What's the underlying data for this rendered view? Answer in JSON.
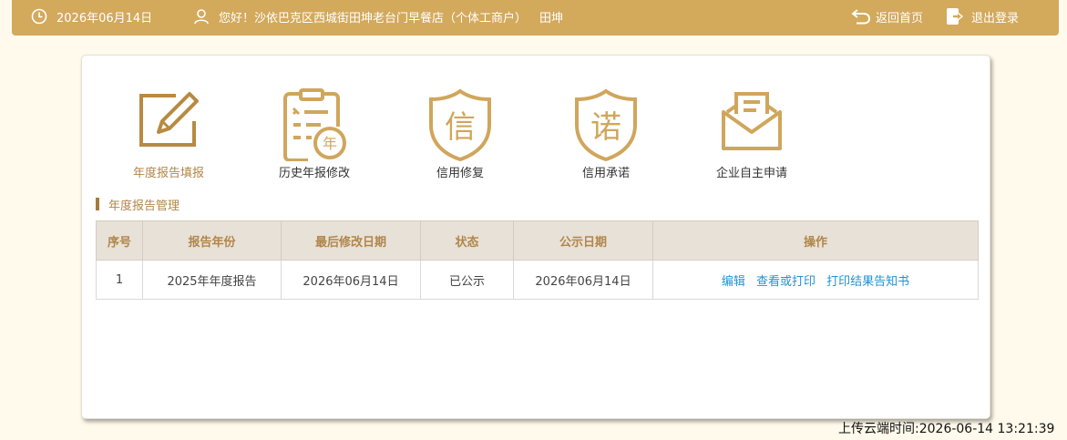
{
  "header": {
    "date": "2026年06月14日",
    "greeting": "您好！沙依巴克区西城街田坤老台门早餐店（个体工商户）",
    "username": "田坤",
    "home_label": "返回首页",
    "logout_label": "退出登录",
    "icons": [
      "clock-icon",
      "user-icon",
      "return-icon",
      "logout-icon"
    ]
  },
  "functions": [
    {
      "label": "年度报告填报",
      "icon": "edit-report-icon",
      "active": true
    },
    {
      "label": "历史年报修改",
      "icon": "clipboard-year-icon",
      "active": false
    },
    {
      "label": "信用修复",
      "icon": "shield-xin-icon",
      "active": false
    },
    {
      "label": "信用承诺",
      "icon": "shield-nuo-icon",
      "active": false
    },
    {
      "label": "企业自主申请",
      "icon": "envelope-icon",
      "active": false
    }
  ],
  "section": {
    "title": "年度报告管理"
  },
  "table": {
    "headers": [
      "序号",
      "报告年份",
      "最后修改日期",
      "状态",
      "公示日期",
      "操作"
    ],
    "rows": [
      {
        "index": "1",
        "year": "2025年年度报告",
        "modified": "2026年06月14日",
        "status": "已公示",
        "published": "2026年06月14日",
        "actions": [
          "编辑",
          "查看或打印",
          "打印结果告知书"
        ]
      }
    ]
  },
  "footer": {
    "upload_time": "上传云端时间:2026-06-14 13:21:39"
  },
  "colors": {
    "header_bg": "#d3a95c",
    "page_bg": "#fffaeb",
    "accent": "#b0864a",
    "link": "#1f94d2",
    "table_header_bg": "#e8e1d8"
  }
}
